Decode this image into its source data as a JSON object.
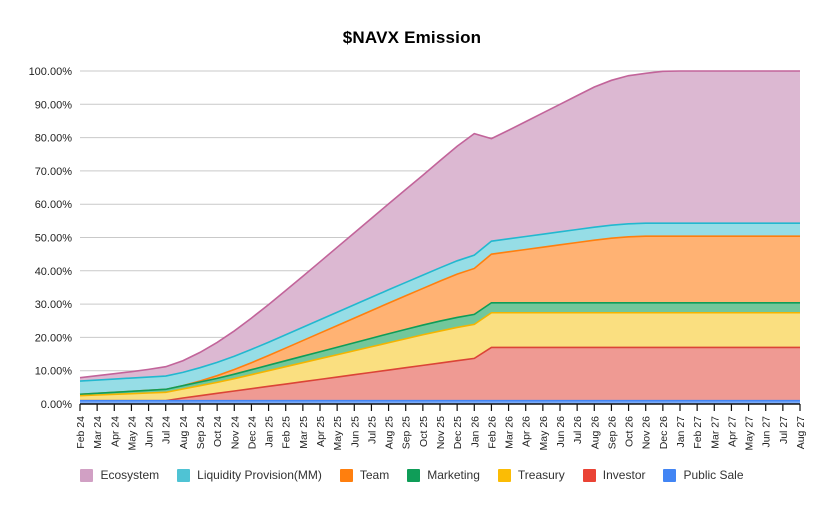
{
  "chart_data": {
    "type": "area",
    "title": "$NAVX Emission",
    "subtitle": "",
    "xlabel": "",
    "ylabel": "",
    "stacked": true,
    "grid": true,
    "legend_position": "bottom",
    "ylim": [
      0,
      1.0
    ],
    "ytick_labels": [
      "0.00%",
      "10.00%",
      "20.00%",
      "30.00%",
      "40.00%",
      "50.00%",
      "60.00%",
      "70.00%",
      "80.00%",
      "90.00%",
      "100.00%"
    ],
    "ytick_values": [
      0,
      10,
      20,
      30,
      40,
      50,
      60,
      70,
      80,
      90,
      100
    ],
    "categories": [
      "Feb 24",
      "Mar 24",
      "Apr 24",
      "May 24",
      "Jun 24",
      "Jul 24",
      "Aug 24",
      "Sep 24",
      "Oct 24",
      "Nov 24",
      "Dec 24",
      "Jan 25",
      "Feb 25",
      "Mar 25",
      "Apr 25",
      "May 25",
      "Jun 25",
      "Jul 25",
      "Aug 25",
      "Sep 25",
      "Oct 25",
      "Nov 25",
      "Dec 25",
      "Jan 26",
      "Feb 26",
      "Mar 26",
      "Apr 26",
      "May 26",
      "Jun 26",
      "Jul 26",
      "Aug 26",
      "Sep 26",
      "Oct 26",
      "Nov 26",
      "Dec 26",
      "Jan 27",
      "Feb 27",
      "Mar 27",
      "Apr 27",
      "May 27",
      "Jun 27",
      "Jul 27",
      "Aug 27"
    ],
    "series": [
      {
        "name": "Public Sale",
        "color": "#4285F4",
        "fill": "#7babf7",
        "values": [
          1.0,
          1.0,
          1.0,
          1.0,
          1.0,
          1.0,
          1.0,
          1.0,
          1.0,
          1.0,
          1.0,
          1.0,
          1.0,
          1.0,
          1.0,
          1.0,
          1.0,
          1.0,
          1.0,
          1.0,
          1.0,
          1.0,
          1.0,
          1.0,
          1.0,
          1.0,
          1.0,
          1.0,
          1.0,
          1.0,
          1.0,
          1.0,
          1.0,
          1.0,
          1.0,
          1.0,
          1.0,
          1.0,
          1.0,
          1.0,
          1.0,
          1.0,
          1.0
        ]
      },
      {
        "name": "Investor",
        "color": "#DB4437",
        "fill": "#ef9a93",
        "values": [
          0.0,
          0.0,
          0.0,
          0.0,
          0.0,
          0.0,
          0.8,
          1.5,
          2.2,
          2.9,
          3.6,
          4.3,
          5.0,
          5.7,
          6.4,
          7.1,
          7.8,
          8.5,
          9.2,
          9.9,
          10.6,
          11.3,
          12.0,
          12.7,
          16.0,
          16.0,
          16.0,
          16.0,
          16.0,
          16.0,
          16.0,
          16.0,
          16.0,
          16.0,
          16.0,
          16.0,
          16.0,
          16.0,
          16.0,
          16.0,
          16.0,
          16.0,
          16.0
        ]
      },
      {
        "name": "Treasury",
        "color": "#F4B400",
        "fill": "#fadf80",
        "values": [
          1.5,
          1.7,
          1.9,
          2.1,
          2.3,
          2.5,
          2.7,
          3.0,
          3.3,
          3.7,
          4.2,
          4.7,
          5.2,
          5.7,
          6.2,
          6.7,
          7.2,
          7.7,
          8.2,
          8.7,
          9.2,
          9.6,
          10.0,
          10.2,
          10.4,
          10.4,
          10.4,
          10.4,
          10.4,
          10.4,
          10.4,
          10.4,
          10.4,
          10.4,
          10.4,
          10.4,
          10.4,
          10.4,
          10.4,
          10.4,
          10.4,
          10.4,
          10.4
        ]
      },
      {
        "name": "Marketing",
        "color": "#0F9D58",
        "fill": "#72c79b",
        "values": [
          0.4,
          0.5,
          0.6,
          0.7,
          0.8,
          0.9,
          1.0,
          1.1,
          1.2,
          1.35,
          1.5,
          1.65,
          1.8,
          1.95,
          2.1,
          2.25,
          2.4,
          2.55,
          2.7,
          2.8,
          2.9,
          3.0,
          3.0,
          3.0,
          3.0,
          3.0,
          3.0,
          3.0,
          3.0,
          3.0,
          3.0,
          3.0,
          3.0,
          3.0,
          3.0,
          3.0,
          3.0,
          3.0,
          3.0,
          3.0,
          3.0,
          3.0,
          3.0
        ]
      },
      {
        "name": "Team",
        "color": "#FF7F0E",
        "fill": "#ffb273",
        "values": [
          0.0,
          0.0,
          0.0,
          0.0,
          0.0,
          0.0,
          0.0,
          0.3,
          0.8,
          1.4,
          2.1,
          2.9,
          3.8,
          4.7,
          5.6,
          6.5,
          7.4,
          8.3,
          9.2,
          10.1,
          11.0,
          12.0,
          13.0,
          13.8,
          14.6,
          15.3,
          16.0,
          16.7,
          17.4,
          18.1,
          18.8,
          19.4,
          19.8,
          20.0,
          20.0,
          20.0,
          20.0,
          20.0,
          20.0,
          20.0,
          20.0,
          20.0,
          20.0
        ]
      },
      {
        "name": "Liquidity Provision(MM)",
        "color": "#22B8CF",
        "fill": "#96dde6",
        "values": [
          4.0,
          4.0,
          4.0,
          4.0,
          4.0,
          4.0,
          4.0,
          4.0,
          4.0,
          4.0,
          4.0,
          4.0,
          4.0,
          4.0,
          4.0,
          4.0,
          4.0,
          4.0,
          4.0,
          4.0,
          4.0,
          4.0,
          4.0,
          4.0,
          3.9,
          3.9,
          3.9,
          3.9,
          3.9,
          3.9,
          3.9,
          3.9,
          3.9,
          3.9,
          3.9,
          3.9,
          3.9,
          3.9,
          3.9,
          3.9,
          3.9,
          3.9,
          3.9
        ]
      },
      {
        "name": "Ecosystem",
        "color": "#C2649A",
        "fill": "#dcb8d2",
        "values": [
          1.0,
          1.3,
          1.6,
          1.9,
          2.3,
          2.8,
          3.5,
          4.6,
          6.0,
          7.6,
          9.4,
          11.3,
          13.3,
          15.3,
          17.4,
          19.5,
          21.6,
          23.7,
          25.8,
          27.9,
          30.0,
          32.2,
          34.4,
          36.5,
          30.8,
          32.6,
          34.5,
          36.4,
          38.3,
          40.2,
          42.1,
          43.5,
          44.5,
          45.0,
          45.6,
          45.7,
          45.7,
          45.7,
          45.7,
          45.7,
          45.7,
          45.7,
          45.7
        ]
      }
    ],
    "total_top_values": [
      7.9,
      8.5,
      9.1,
      9.7,
      10.4,
      11.2,
      13.0,
      15.5,
      18.5,
      21.95,
      25.8,
      29.85,
      34.1,
      38.35,
      42.7,
      47.05,
      51.4,
      55.75,
      60.1,
      64.4,
      68.7,
      73.1,
      77.4,
      81.2,
      81.7,
      84.2,
      86.8,
      89.4,
      92.0,
      94.6,
      97.2,
      99.2,
      100.6,
      101.3,
      101.9,
      102.0,
      102.0,
      102.0,
      102.0,
      102.0,
      102.0,
      102.0,
      102.0
    ]
  },
  "legend": {
    "items": [
      {
        "label": "Ecosystem",
        "color": "#d1a0c4"
      },
      {
        "label": "Liquidity Provision(MM)",
        "color": "#4fc3d4"
      },
      {
        "label": "Team",
        "color": "#ff7f0e"
      },
      {
        "label": "Marketing",
        "color": "#0f9d58"
      },
      {
        "label": "Treasury",
        "color": "#fbbc05"
      },
      {
        "label": "Investor",
        "color": "#ea4335"
      },
      {
        "label": "Public Sale",
        "color": "#4285f4"
      }
    ]
  }
}
